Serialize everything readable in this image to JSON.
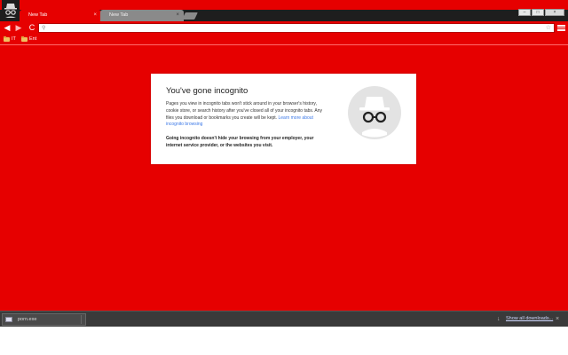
{
  "tabs": [
    {
      "title": "New Tab",
      "close": "×"
    },
    {
      "title": "New Tab",
      "close": "×"
    }
  ],
  "window_controls": {
    "minimize": "–",
    "maximize": "□",
    "close": "×"
  },
  "toolbar": {
    "back": "◀",
    "forward": "▶",
    "reload": "C",
    "omnibox_value": "",
    "star": "☆"
  },
  "bookmarks": [
    {
      "label": "IT"
    },
    {
      "label": "Ent"
    }
  ],
  "incognito": {
    "heading": "You've gone incognito",
    "body_text": "Pages you view in incognito tabs won't stick around in your browser's history, cookie store, or search history after you've closed all of your incognito tabs. Any files you download or bookmarks you create will be kept. ",
    "learn_more": "Learn more about incognito browsing",
    "bold_text": "Going incognito doesn't hide your browsing from your employer, your internet service provider, or the websites you visit."
  },
  "downloads": {
    "filename": "porn.exe",
    "show_all": "Show all downloads...",
    "close": "×"
  },
  "colors": {
    "accent": "#e60000",
    "tab_inactive": "#8a8a8a",
    "link": "#3b78e7"
  }
}
